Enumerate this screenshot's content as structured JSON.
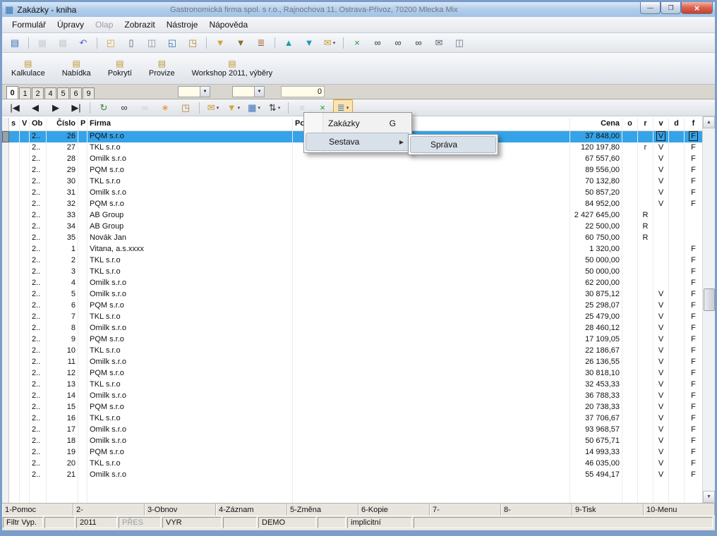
{
  "window": {
    "title": "Zakázky - kniha",
    "background_title": "Gastronomická firma spol. s r.o., Rajnochova 11, Ostrava-Přívoz, 70200        Mlecka Mix",
    "controls": {
      "minimize_glyph": "—",
      "maximize_glyph": "❐",
      "close_glyph": "×"
    }
  },
  "icons": {
    "app": "▦",
    "submenu-arrow": "▶",
    "scroll-up": "▲",
    "scroll-down": "▼",
    "dropdown-arrow": "▾",
    "combo-arrow": "▼"
  },
  "menu_bar": {
    "items": [
      {
        "name": "menu-formular",
        "label": "Formulář"
      },
      {
        "name": "menu-upravy",
        "label": "Úpravy"
      },
      {
        "name": "menu-olap",
        "label": "Olap",
        "disabled": true
      },
      {
        "name": "menu-zobrazit",
        "label": "Zobrazit"
      },
      {
        "name": "menu-nastroje",
        "label": "Nástroje"
      },
      {
        "name": "menu-napoveda",
        "label": "Nápověda"
      }
    ]
  },
  "toolbar_icons": [
    {
      "name": "form-navigator-icon",
      "glyph": "▤",
      "color": "#3a6fb5"
    },
    {
      "sep": true
    },
    {
      "name": "save-icon",
      "glyph": "▦",
      "color": "#9aa0a6",
      "disabled": true
    },
    {
      "name": "save-close-icon",
      "glyph": "▩",
      "color": "#9aa0a6",
      "disabled": true
    },
    {
      "name": "undo-icon",
      "glyph": "↶",
      "color": "#4f63cf"
    },
    {
      "sep": true
    },
    {
      "name": "open-folder-icon",
      "glyph": "◰",
      "color": "#d8a33a"
    },
    {
      "name": "new-document-icon",
      "glyph": "▯",
      "color": "#56606e"
    },
    {
      "name": "print-icon",
      "glyph": "◫",
      "color": "#8a9097"
    },
    {
      "name": "copy-icon",
      "glyph": "◱",
      "color": "#3a6fb5"
    },
    {
      "name": "paste-icon",
      "glyph": "◳",
      "color": "#b5862e"
    },
    {
      "sep": true
    },
    {
      "name": "filter-icon",
      "glyph": "▼",
      "color": "#d3a535"
    },
    {
      "name": "filter-edit-icon",
      "glyph": "▼",
      "color": "#8a6f2a"
    },
    {
      "name": "layers-icon",
      "glyph": "≣",
      "color": "#a05a28"
    },
    {
      "sep": true
    },
    {
      "name": "move-up-icon",
      "glyph": "▲",
      "color": "#18a0b0"
    },
    {
      "name": "move-down-icon",
      "glyph": "▼",
      "color": "#18a0b0"
    },
    {
      "name": "mail-merge-icon",
      "glyph": "✉",
      "color": "#c79a2e",
      "dropdown": true
    },
    {
      "sep": true
    },
    {
      "name": "export-excel-icon",
      "glyph": "×",
      "color": "#1f9d3a"
    },
    {
      "name": "find-icon",
      "glyph": "∞",
      "color": "#30343a"
    },
    {
      "name": "find-in-results-icon",
      "glyph": "∞",
      "color": "#30343a"
    },
    {
      "name": "find-special-icon",
      "glyph": "∞",
      "color": "#30343a"
    },
    {
      "name": "send-mail-icon",
      "glyph": "✉",
      "color": "#5a6068"
    },
    {
      "name": "print-report-icon",
      "glyph": "◫",
      "color": "#6d7480"
    }
  ],
  "action_buttons": [
    {
      "name": "kalkulace-button",
      "label": "Kalkulace"
    },
    {
      "name": "nabidka-button",
      "label": "Nabídka"
    },
    {
      "name": "pokryti-button",
      "label": "Pokrytí"
    },
    {
      "name": "provize-button",
      "label": "Provize"
    },
    {
      "name": "workshop-button",
      "label": "Workshop 2011, výběry"
    }
  ],
  "tab_bar": {
    "tabs": [
      "0",
      "1",
      "2",
      "4",
      "5",
      "6",
      "9"
    ],
    "active": "0",
    "combo1_value": "",
    "combo2_value": "",
    "counter": "0"
  },
  "nav_icons": [
    {
      "name": "first-record-icon",
      "glyph": "|◀",
      "color": "#222"
    },
    {
      "name": "prev-record-icon",
      "glyph": "◀",
      "color": "#222"
    },
    {
      "name": "next-record-icon",
      "glyph": "▶",
      "color": "#222"
    },
    {
      "name": "last-record-icon",
      "glyph": "▶|",
      "color": "#222"
    },
    {
      "sep": true
    },
    {
      "name": "refresh-icon",
      "glyph": "↻",
      "color": "#2e8540"
    },
    {
      "name": "find-records-icon",
      "glyph": "∞",
      "color": "#30343a"
    },
    {
      "name": "find-next-icon",
      "glyph": "∞",
      "color": "#9aa0a6",
      "disabled": true
    },
    {
      "name": "favorites-icon",
      "glyph": "∗",
      "color": "#e8952e"
    },
    {
      "name": "attach-icon",
      "glyph": "◳",
      "color": "#b5862e"
    },
    {
      "sep": true
    },
    {
      "name": "mail-icon",
      "glyph": "✉",
      "color": "#c79a2e",
      "dropdown": true
    },
    {
      "name": "filter-icon",
      "glyph": "▼",
      "color": "#d3a535",
      "dropdown": true
    },
    {
      "name": "grid-view-icon",
      "glyph": "▦",
      "color": "#3a6fb5",
      "dropdown": true
    },
    {
      "name": "sort-icon",
      "glyph": "⇅",
      "color": "#30343a",
      "dropdown": true
    },
    {
      "sep": true
    },
    {
      "name": "list-icon",
      "glyph": "≡",
      "color": "#9aa0a6",
      "disabled": true
    },
    {
      "name": "excel-export-icon",
      "glyph": "×",
      "color": "#1f9d3a"
    },
    {
      "name": "reports-menu-icon",
      "glyph": "≣",
      "color": "#3a6fb5",
      "dropdown": true,
      "pressed": true
    }
  ],
  "table": {
    "columns": [
      "s",
      "V",
      "Ob",
      "Číslo",
      "P",
      "Firma",
      "Po",
      "Cena",
      "o",
      "r",
      "v",
      "d",
      "f"
    ],
    "rows": [
      {
        "ob": "2..",
        "cislo": "26",
        "firma": "PQM s.r.o",
        "cena": "37 848,00",
        "v": "V",
        "f": "F",
        "selected": true
      },
      {
        "ob": "2..",
        "cislo": "27",
        "firma": "TKL s.r.o",
        "cena": "120 197,80",
        "r": "r",
        "v": "V",
        "f": "F"
      },
      {
        "ob": "2..",
        "cislo": "28",
        "firma": "Omilk s.r.o",
        "cena": "67 557,60",
        "v": "V",
        "f": "F"
      },
      {
        "ob": "2..",
        "cislo": "29",
        "firma": "PQM s.r.o",
        "cena": "89 556,00",
        "v": "V",
        "f": "F"
      },
      {
        "ob": "2..",
        "cislo": "30",
        "firma": "TKL s.r.o",
        "cena": "70 132,80",
        "v": "V",
        "f": "F"
      },
      {
        "ob": "2..",
        "cislo": "31",
        "firma": "Omilk s.r.o",
        "cena": "50 857,20",
        "v": "V",
        "f": "F"
      },
      {
        "ob": "2..",
        "cislo": "32",
        "firma": "PQM s.r.o",
        "cena": "84 952,00",
        "v": "V",
        "f": "F"
      },
      {
        "ob": "2..",
        "cislo": "33",
        "firma": "AB Group",
        "cena": "2 427 645,00",
        "r": "R"
      },
      {
        "ob": "2..",
        "cislo": "34",
        "firma": "AB Group",
        "cena": "22 500,00",
        "r": "R"
      },
      {
        "ob": "2..",
        "cislo": "35",
        "firma": "Novák Jan",
        "cena": "60 750,00",
        "r": "R"
      },
      {
        "ob": "2..",
        "cislo": "1",
        "firma": "Vitana, a.s.xxxx",
        "cena": "1 320,00",
        "f": "F"
      },
      {
        "ob": "2..",
        "cislo": "2",
        "firma": "TKL s.r.o",
        "cena": "50 000,00",
        "f": "F"
      },
      {
        "ob": "2..",
        "cislo": "3",
        "firma": "TKL s.r.o",
        "cena": "50 000,00",
        "f": "F"
      },
      {
        "ob": "2..",
        "cislo": "4",
        "firma": "Omilk s.r.o",
        "cena": "62 200,00",
        "f": "F"
      },
      {
        "ob": "2..",
        "cislo": "5",
        "firma": "Omilk s.r.o",
        "cena": "30 875,12",
        "v": "V",
        "f": "F"
      },
      {
        "ob": "2..",
        "cislo": "6",
        "firma": "PQM s.r.o",
        "cena": "25 298,07",
        "v": "V",
        "f": "F"
      },
      {
        "ob": "2..",
        "cislo": "7",
        "firma": "TKL s.r.o",
        "cena": "25 479,00",
        "v": "V",
        "f": "F"
      },
      {
        "ob": "2..",
        "cislo": "8",
        "firma": "Omilk s.r.o",
        "cena": "28 460,12",
        "v": "V",
        "f": "F"
      },
      {
        "ob": "2..",
        "cislo": "9",
        "firma": "PQM s.r.o",
        "cena": "17 109,05",
        "v": "V",
        "f": "F"
      },
      {
        "ob": "2..",
        "cislo": "10",
        "firma": "TKL s.r.o",
        "cena": "22 186,67",
        "v": "V",
        "f": "F"
      },
      {
        "ob": "2..",
        "cislo": "11",
        "firma": "Omilk s.r.o",
        "cena": "26 136,55",
        "v": "V",
        "f": "F"
      },
      {
        "ob": "2..",
        "cislo": "12",
        "firma": "PQM s.r.o",
        "cena": "30 818,10",
        "v": "V",
        "f": "F"
      },
      {
        "ob": "2..",
        "cislo": "13",
        "firma": "TKL s.r.o",
        "cena": "32 453,33",
        "v": "V",
        "f": "F"
      },
      {
        "ob": "2..",
        "cislo": "14",
        "firma": "Omilk s.r.o",
        "cena": "36 788,33",
        "v": "V",
        "f": "F"
      },
      {
        "ob": "2..",
        "cislo": "15",
        "firma": "PQM s.r.o",
        "cena": "20 738,33",
        "v": "V",
        "f": "F"
      },
      {
        "ob": "2..",
        "cislo": "16",
        "firma": "TKL s.r.o",
        "cena": "37 706,67",
        "v": "V",
        "f": "F"
      },
      {
        "ob": "2..",
        "cislo": "17",
        "firma": "Omilk s.r.o",
        "cena": "93 968,57",
        "v": "V",
        "f": "F"
      },
      {
        "ob": "2..",
        "cislo": "18",
        "firma": "Omilk s.r.o",
        "cena": "50 675,71",
        "v": "V",
        "f": "F"
      },
      {
        "ob": "2..",
        "cislo": "19",
        "firma": "PQM s.r.o",
        "cena": "14 993,33",
        "v": "V",
        "f": "F"
      },
      {
        "ob": "2..",
        "cislo": "20",
        "firma": "TKL s.r.o",
        "cena": "46 035,00",
        "v": "V",
        "f": "F"
      },
      {
        "ob": "2..",
        "cislo": "21",
        "firma": "Omilk s.r.o",
        "cena": "55 494,17",
        "v": "V",
        "f": "F"
      }
    ]
  },
  "context_menu": {
    "items": [
      {
        "label": "Zakázky",
        "shortcut": "G"
      },
      {
        "label": "Sestava",
        "has_submenu": true,
        "highlighted": true
      }
    ],
    "submenu_items": [
      {
        "label": "Správa",
        "highlighted": true
      }
    ]
  },
  "function_keys": [
    "1-Pomoc",
    "2-",
    "3-Obnov",
    "4-Záznam",
    "5-Změna",
    "6-Kopie",
    "7-",
    "8-",
    "9-Tisk",
    "10-Menu"
  ],
  "status_bar": [
    {
      "text": "Filtr Vyp.",
      "width": 57
    },
    {
      "text": "",
      "width": 43
    },
    {
      "text": "2011",
      "width": 58
    },
    {
      "text": "PŘES",
      "width": 60,
      "dim": true
    },
    {
      "text": "VYR",
      "width": 84
    },
    {
      "text": "",
      "width": 48
    },
    {
      "text": "DEMO",
      "width": 82
    },
    {
      "text": "",
      "width": 40
    },
    {
      "text": "implicitní",
      "width": 92
    },
    {
      "text": "",
      "width": 0,
      "grow": true
    }
  ]
}
